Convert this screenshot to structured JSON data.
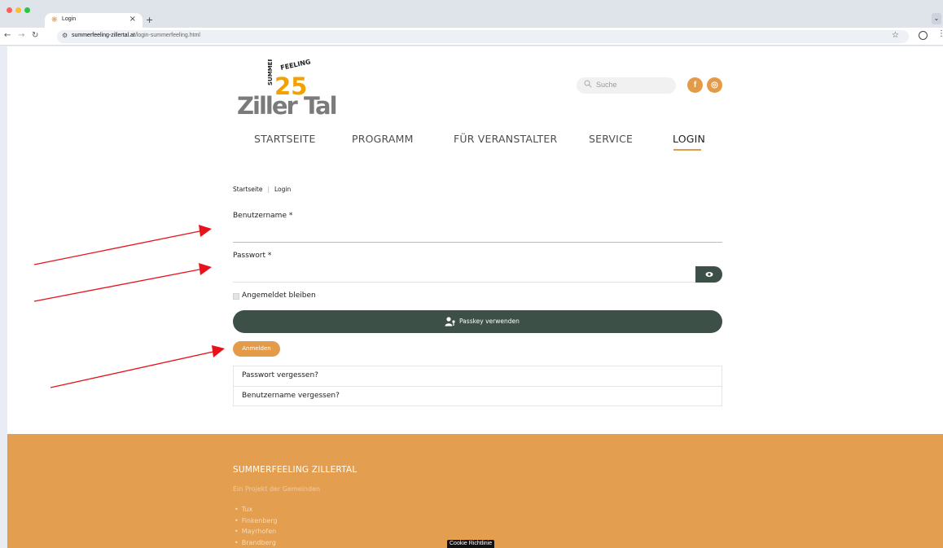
{
  "browser": {
    "tab_title": "Login",
    "new_tab": "+",
    "close": "×",
    "url_domain": "summerfeeling-zillertal.at",
    "url_path": "/login-summerfeeling.html"
  },
  "header": {
    "logo": {
      "summer": "SUMMER",
      "feeling": "FEELING",
      "year": "25",
      "brand_a": "Ziller",
      "brand_b": "Tal"
    },
    "search_placeholder": "Suche",
    "social": {
      "facebook": "f",
      "instagram": "◎"
    }
  },
  "nav": {
    "items": [
      {
        "label": "STARTSEITE"
      },
      {
        "label": "PROGRAMM"
      },
      {
        "label": "FÜR VERANSTALTER"
      },
      {
        "label": "SERVICE"
      },
      {
        "label": "LOGIN"
      }
    ]
  },
  "breadcrumb": {
    "home": "Startseite",
    "sep": "|",
    "current": "Login"
  },
  "form": {
    "username_label": "Benutzername *",
    "password_label": "Passwort *",
    "remember_label": "Angemeldet bleiben",
    "passkey_label": "Passkey verwenden",
    "login_label": "Anmelden",
    "forgot_password": "Passwort vergessen?",
    "forgot_username": "Benutzername vergessen?"
  },
  "footer": {
    "title": "SUMMERFEELING ZILLERTAL",
    "subtitle": "Ein Projekt der Gemeinden",
    "towns": [
      "Tux",
      "Finkenberg",
      "Mayrhofen",
      "Brandberg"
    ],
    "cookie_label": "Cookie Richtlinie"
  },
  "colors": {
    "accent_orange": "#e39b4a",
    "dark_green": "#3d5048",
    "annotation_red": "#e8121b"
  }
}
